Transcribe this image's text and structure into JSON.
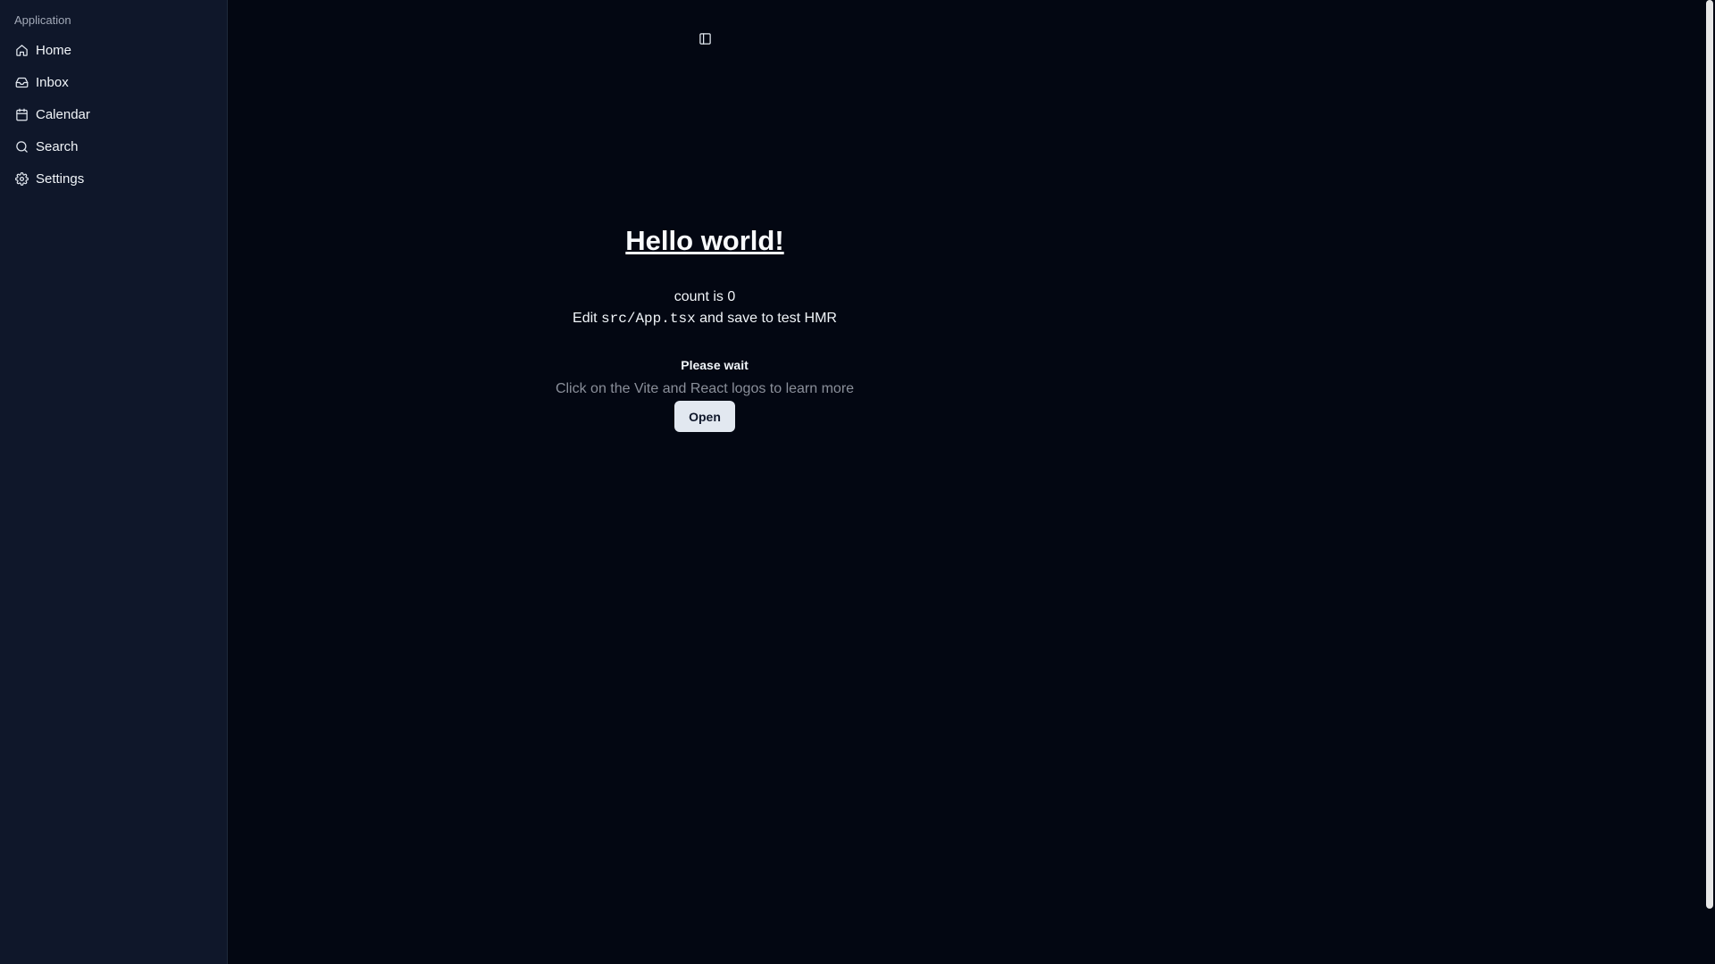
{
  "sidebar": {
    "group_label": "Application",
    "items": [
      {
        "label": "Home",
        "icon": "home-icon"
      },
      {
        "label": "Inbox",
        "icon": "inbox-icon"
      },
      {
        "label": "Calendar",
        "icon": "calendar-icon"
      },
      {
        "label": "Search",
        "icon": "search-icon"
      },
      {
        "label": "Settings",
        "icon": "gear-icon"
      }
    ]
  },
  "header": {
    "trigger_icon": "sidebar-toggle-icon"
  },
  "main": {
    "title": "Hello world!",
    "count_text": "count is 0",
    "edit_prefix": "Edit",
    "edit_code": "src/App.tsx",
    "edit_suffix": "and save to test HMR",
    "wait_text": "Please wait",
    "hint_text": "Click on the Vite and React logos to learn more",
    "open_label": "Open"
  },
  "colors": {
    "background": "#030712",
    "sidebar_bg": "#0f172a",
    "button_bg": "#e2e8f0",
    "hint_text": "#8a8f9a"
  }
}
